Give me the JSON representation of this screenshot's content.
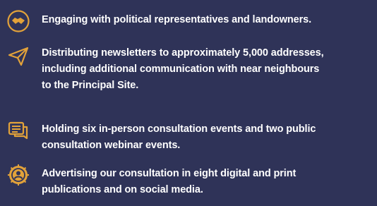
{
  "colors": {
    "background": "#2f3358",
    "icon_accent": "#e2a23a",
    "text": "#ffffff"
  },
  "items": [
    {
      "icon": "handshake-icon",
      "text": "Engaging with political representatives and landowners."
    },
    {
      "icon": "paper-plane-icon",
      "text": "Distributing newsletters to approximately 5,000 addresses,\nincluding additional communication with near neighbours\nto the Principal Site."
    },
    {
      "icon": "chat-bubbles-icon",
      "text": "Holding six in-person consultation events and two public\nconsultation webinar events."
    },
    {
      "icon": "megaphone-badge-icon",
      "text": "Advertising our consultation in eight digital and print\npublications and on social media."
    }
  ]
}
